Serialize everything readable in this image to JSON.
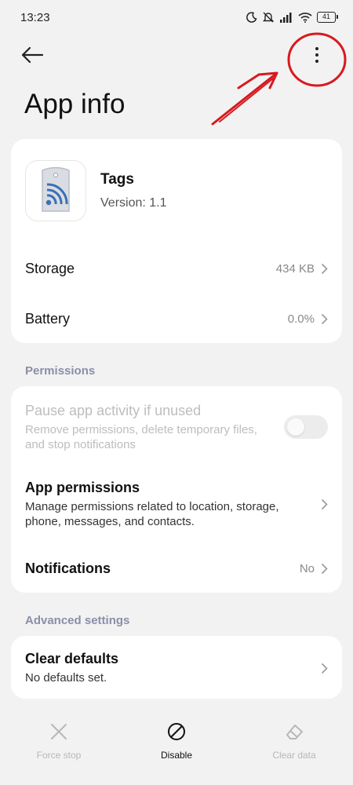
{
  "status_bar": {
    "time": "13:23",
    "battery_level": "41"
  },
  "header": {
    "title": "App info"
  },
  "app": {
    "name": "Tags",
    "version": "Version: 1.1"
  },
  "storage": {
    "label": "Storage",
    "value": "434 KB"
  },
  "battery": {
    "label": "Battery",
    "value": "0.0%"
  },
  "permissions": {
    "section_label": "Permissions",
    "pause": {
      "title": "Pause app activity if unused",
      "subtitle": "Remove permissions, delete temporary files, and stop notifications",
      "enabled": false
    },
    "app_permissions": {
      "title": "App permissions",
      "subtitle": "Manage permissions related to location, storage, phone, messages, and contacts."
    },
    "notifications": {
      "title": "Notifications",
      "value": "No"
    }
  },
  "advanced": {
    "section_label": "Advanced settings",
    "clear_defaults": {
      "title": "Clear defaults",
      "subtitle": "No defaults set."
    }
  },
  "bottom_actions": {
    "force_stop": "Force stop",
    "disable": "Disable",
    "clear_data": "Clear data"
  },
  "colors": {
    "accent_annotation": "#d71a1f",
    "section_header": "#8a8fa8"
  }
}
